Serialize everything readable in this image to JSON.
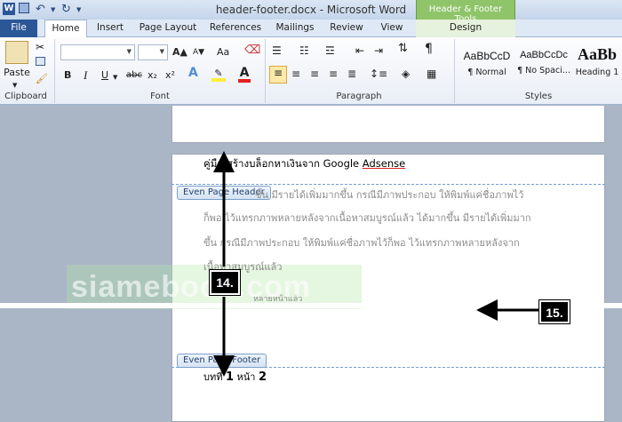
{
  "window": {
    "title": "header-footer.docx - Microsoft Word",
    "contextual_tab_group": "Header & Footer Tools"
  },
  "quick_access": {
    "app_icon": "word-icon",
    "save": "save-icon",
    "undo": "↶",
    "redo": "↻"
  },
  "tabs": [
    "File",
    "Home",
    "Insert",
    "Page Layout",
    "References",
    "Mailings",
    "Review",
    "View",
    "Design"
  ],
  "ribbon": {
    "clipboard": {
      "paste_label": "Paste",
      "group_label": "Clipboard"
    },
    "font": {
      "group_label": "Font",
      "bold": "B",
      "italic": "I",
      "underline": "U",
      "strike": "abc",
      "subscript": "x₂",
      "superscript": "x²",
      "grow": "A▲",
      "shrink": "A▼",
      "change_case": "Aa"
    },
    "paragraph": {
      "group_label": "Paragraph",
      "pilcrow": "¶"
    },
    "styles": {
      "group_label": "Styles",
      "items": [
        {
          "sample": "AaBbCcD",
          "name": "¶ Normal"
        },
        {
          "sample": "AaBbCcDc",
          "name": "¶ No Spaci..."
        },
        {
          "sample": "AaBb",
          "name": "Heading 1"
        }
      ]
    }
  },
  "document": {
    "header_text_prefix": "คู่มือ สร้างบล็อกหาเงินจาก Google ",
    "header_text_link": "Adsense",
    "even_page_header_tag": "Even Page Header",
    "even_page_footer_tag": "Even Page Footer",
    "body_lines": [
      "ชิ้น  มีรายได้เพิ่มมากขึ้น   กรณีมีภาพประกอบ  ให้พิมพ์แค่ชื่อภาพไว้",
      "ก็พอ  ไว้แทรกภาพหลายหลังจากเนื้อหาสมบูรณ์แล้ว  ได้มากขึ้น  มีรายได้เพิ่มมาก",
      "ขึ้น    กรณีมีภาพประกอบ   ให้พิมพ์แค่ชื่อภาพไว้ก็พอ   ไว้แทรกภาพหลายหลังจาก",
      "เนื้อหาสมบูรณ์แล้ว",
      "หลายหน้าแล้ว"
    ],
    "footer_prefix": "บทที่ ",
    "footer_chapter": "1",
    "footer_mid": " หน้า ",
    "footer_page": "2"
  },
  "watermark": "siamebook.com",
  "annotations": {
    "label_14": "14.",
    "label_15": "15."
  }
}
